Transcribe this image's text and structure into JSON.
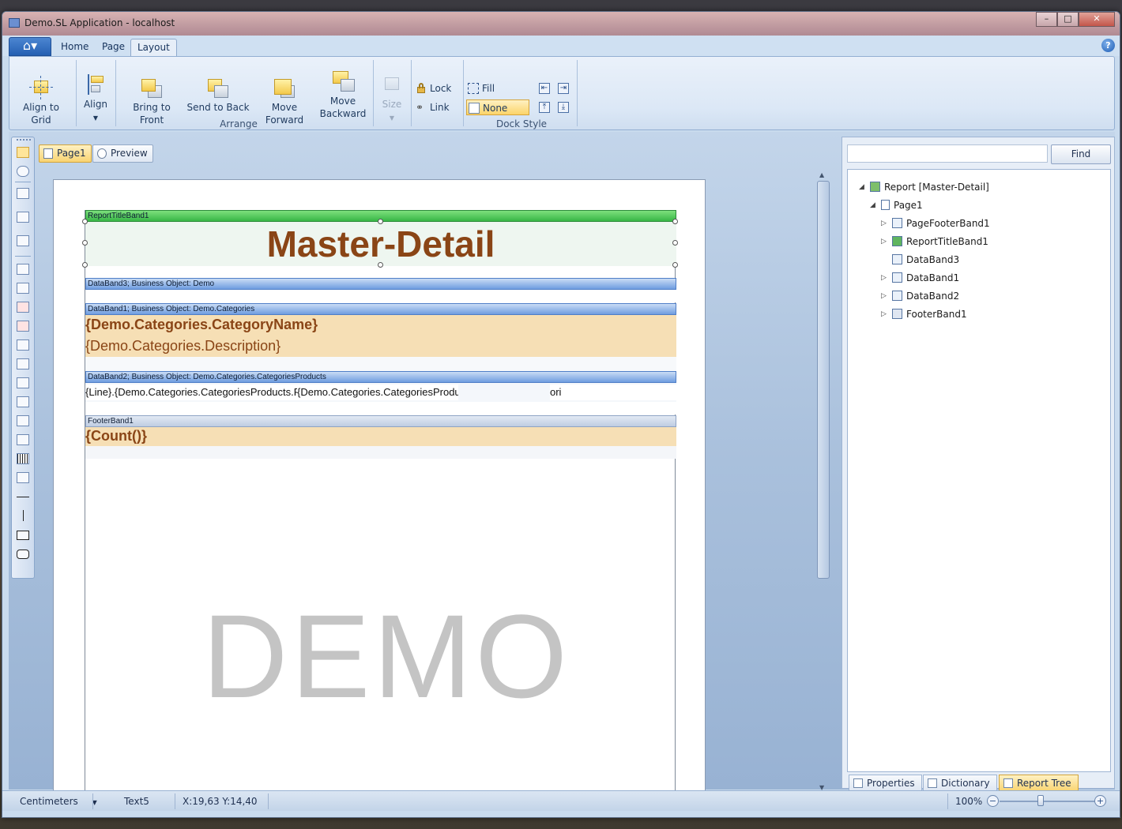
{
  "window": {
    "title": "Demo.SL Application - localhost",
    "controls": {
      "minimize": "–",
      "maximize": "□",
      "close": "✕"
    }
  },
  "ribbon": {
    "tabs": [
      "Home",
      "Page",
      "Layout"
    ],
    "active_tab": "Layout",
    "help": "?",
    "arrange": {
      "align_to_grid": "Align to Grid",
      "align": "Align",
      "bring_to_front": "Bring to Front",
      "send_to_back": "Send to Back",
      "move_forward": "Move Forward",
      "move_backward_line1": "Move",
      "move_backward_line2": "Backward",
      "size": "Size",
      "lock": "Lock",
      "link": "Link",
      "label": "Arrange"
    },
    "dock_style": {
      "fill": "Fill",
      "none": "None",
      "label": "Dock Style"
    }
  },
  "page_tabs": {
    "page1": "Page1",
    "preview": "Preview"
  },
  "report": {
    "bands": {
      "report_title": "ReportTitleBand1",
      "databand3": "DataBand3; Business Object: Demo",
      "databand1": "DataBand1; Business Object: Demo.Categories",
      "databand2": "DataBand2; Business Object: Demo.Categories.CategoriesProducts",
      "footer": "FooterBand1"
    },
    "title_text": "Master-Detail",
    "category_name": "{Demo.Categories.CategoryName}",
    "category_description": "{Demo.Categories.Description}",
    "product_cell1": "{Line}.{Demo.Categories.CategoriesProducts.ProductName}",
    "product_cell2": "{Demo.Categories.CategoriesProducts.QuantityPerUnit}",
    "product_cell3": "ori",
    "count": "{Count()}",
    "watermark": "DEMO"
  },
  "right_panel": {
    "find_placeholder": "",
    "find_button": "Find",
    "tree": [
      {
        "label": "Report [Master-Detail]",
        "level": 0,
        "expander": "◢"
      },
      {
        "label": "Page1",
        "level": 1,
        "expander": "◢"
      },
      {
        "label": "PageFooterBand1",
        "level": 2,
        "expander": "▷"
      },
      {
        "label": "ReportTitleBand1",
        "level": 2,
        "expander": "▷"
      },
      {
        "label": "DataBand3",
        "level": 2,
        "expander": ""
      },
      {
        "label": "DataBand1",
        "level": 2,
        "expander": "▷"
      },
      {
        "label": "DataBand2",
        "level": 2,
        "expander": "▷"
      },
      {
        "label": "FooterBand1",
        "level": 2,
        "expander": "▷"
      }
    ],
    "tabs": {
      "properties": "Properties",
      "dictionary": "Dictionary",
      "report_tree": "Report Tree"
    }
  },
  "statusbar": {
    "units": "Centimeters",
    "selected": "Text5",
    "coords": "X:19,63  Y:14,40",
    "zoom": "100%"
  }
}
